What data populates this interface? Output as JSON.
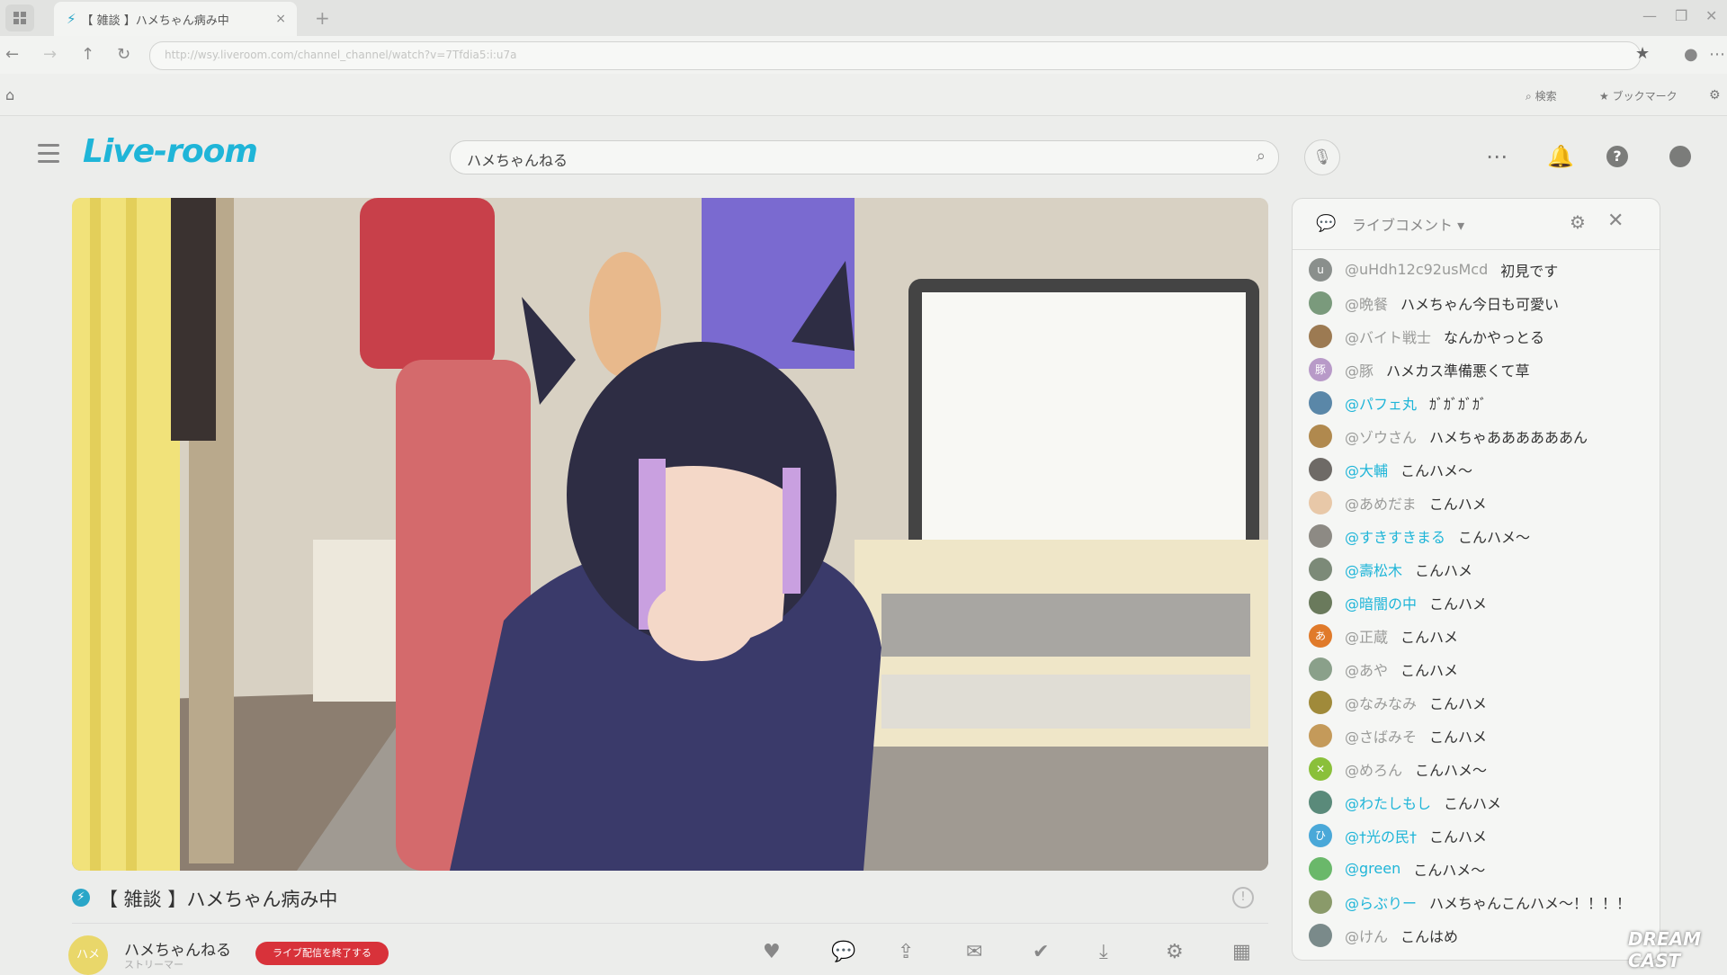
{
  "browser": {
    "tab_title": "【 雑談 】ハメちゃん病み中",
    "tab_close": "×",
    "new_tab": "+",
    "address": "http://wsy.liveroom.com/channel_channel/watch?v=7Tfdia5:i:u7a",
    "bookmarks": [
      {
        "label": "検索"
      },
      {
        "label": "ブックマーク"
      }
    ]
  },
  "site": {
    "logo": "Live-room",
    "search_value": "ハメちゃんねる"
  },
  "video": {
    "title": "【 雑談 】ハメちゃん病み中",
    "channel_name": "ハメちゃんねる",
    "channel_sub": "ストリーマー",
    "avatar_text": "ハメ",
    "end_button": "ライブ配信を終了する"
  },
  "chat": {
    "title": "ライブコメント ▾",
    "comments": [
      {
        "user": "@uHdh12c92usMcd",
        "msg": "初見です",
        "avatar": "u",
        "color": "#8a8f8c",
        "highlight": false
      },
      {
        "user": "@晩餐",
        "msg": "ハメちゃん今日も可愛い",
        "avatar": "",
        "color": "#7a9a7c",
        "highlight": false
      },
      {
        "user": "@バイト戦士",
        "msg": "なんかやっとる",
        "avatar": "",
        "color": "#9c7a52",
        "highlight": false
      },
      {
        "user": "@豚",
        "msg": "ハメカス準備悪くて草",
        "avatar": "豚",
        "color": "#b89ac8",
        "highlight": false
      },
      {
        "user": "@パフェ丸",
        "msg": "ｶﾞｶﾞｶﾞｶﾞ",
        "avatar": "",
        "color": "#5a87a8",
        "highlight": true
      },
      {
        "user": "@ゾウさん",
        "msg": "ハメちゃああああああん",
        "avatar": "",
        "color": "#b0894e",
        "highlight": false
      },
      {
        "user": "@大輔",
        "msg": "こんハメ～",
        "avatar": "",
        "color": "#6e6a66",
        "highlight": true
      },
      {
        "user": "@あめだま",
        "msg": "こんハメ",
        "avatar": "",
        "color": "#e8c8a8",
        "highlight": false
      },
      {
        "user": "@すきすきまる",
        "msg": "こんハメ～",
        "avatar": "",
        "color": "#8d8a84",
        "highlight": true
      },
      {
        "user": "@壽松木",
        "msg": "こんハメ",
        "avatar": "",
        "color": "#7c8a78",
        "highlight": true
      },
      {
        "user": "@暗闇の中",
        "msg": "こんハメ",
        "avatar": "",
        "color": "#6a7a5c",
        "highlight": true
      },
      {
        "user": "@正蔵",
        "msg": "こんハメ",
        "avatar": "あ",
        "color": "#e07a2a",
        "highlight": false
      },
      {
        "user": "@あや",
        "msg": "こんハメ",
        "avatar": "",
        "color": "#8aa08a",
        "highlight": false
      },
      {
        "user": "@なみなみ",
        "msg": "こんハメ",
        "avatar": "",
        "color": "#a08a3a",
        "highlight": false
      },
      {
        "user": "@さばみそ",
        "msg": "こんハメ",
        "avatar": "",
        "color": "#c49a5a",
        "highlight": false
      },
      {
        "user": "@めろん",
        "msg": "こんハメ～",
        "avatar": "✕",
        "color": "#8ac03a",
        "highlight": false
      },
      {
        "user": "@わたしもし",
        "msg": "こんハメ",
        "avatar": "",
        "color": "#5a8a7a",
        "highlight": true
      },
      {
        "user": "@†光の民†",
        "msg": "こんハメ",
        "avatar": "ひ",
        "color": "#4aa8d8",
        "highlight": true
      },
      {
        "user": "@green",
        "msg": "こんハメ～",
        "avatar": "",
        "color": "#6ab86a",
        "highlight": true
      },
      {
        "user": "@らぶりー",
        "msg": "ハメちゃんこんハメ～！！！！",
        "avatar": "",
        "color": "#8a9a6a",
        "highlight": true
      },
      {
        "user": "@けん",
        "msg": "こんはめ",
        "avatar": "",
        "color": "#7a8a8a",
        "highlight": false
      }
    ]
  },
  "watermark": "DREAM CAST"
}
